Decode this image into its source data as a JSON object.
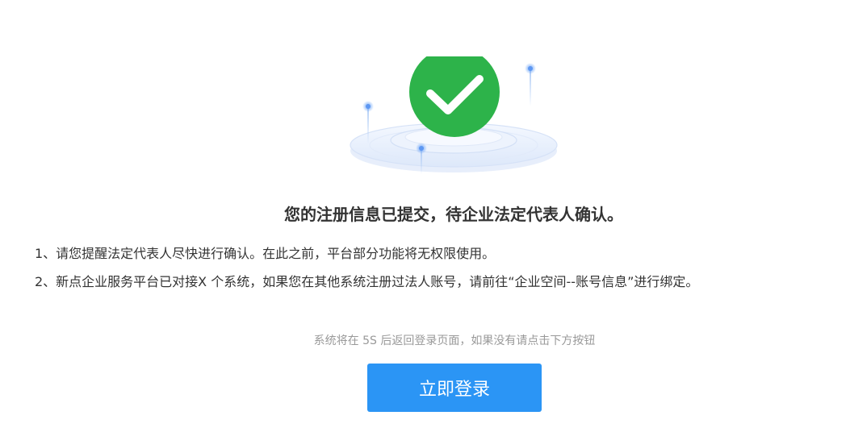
{
  "status": {
    "icon": "check-circle-icon",
    "color": "#2db34a",
    "title": "您的注册信息已提交，待企业法定代表人确认。"
  },
  "notes": [
    "1、请您提醒法定代表人尽快进行确认。在此之前，平台部分功能将无权限使用。",
    "2、新点企业服务平台已对接X 个系统，如果您在其他系统注册过法人账号，请前往“企业空间--账号信息”进行绑定。"
  ],
  "redirect": {
    "message": "系统将在 5S 后返回登录页面，如果没有请点击下方按钮"
  },
  "login_button": {
    "label": "立即登录",
    "color": "#2b95f5"
  }
}
